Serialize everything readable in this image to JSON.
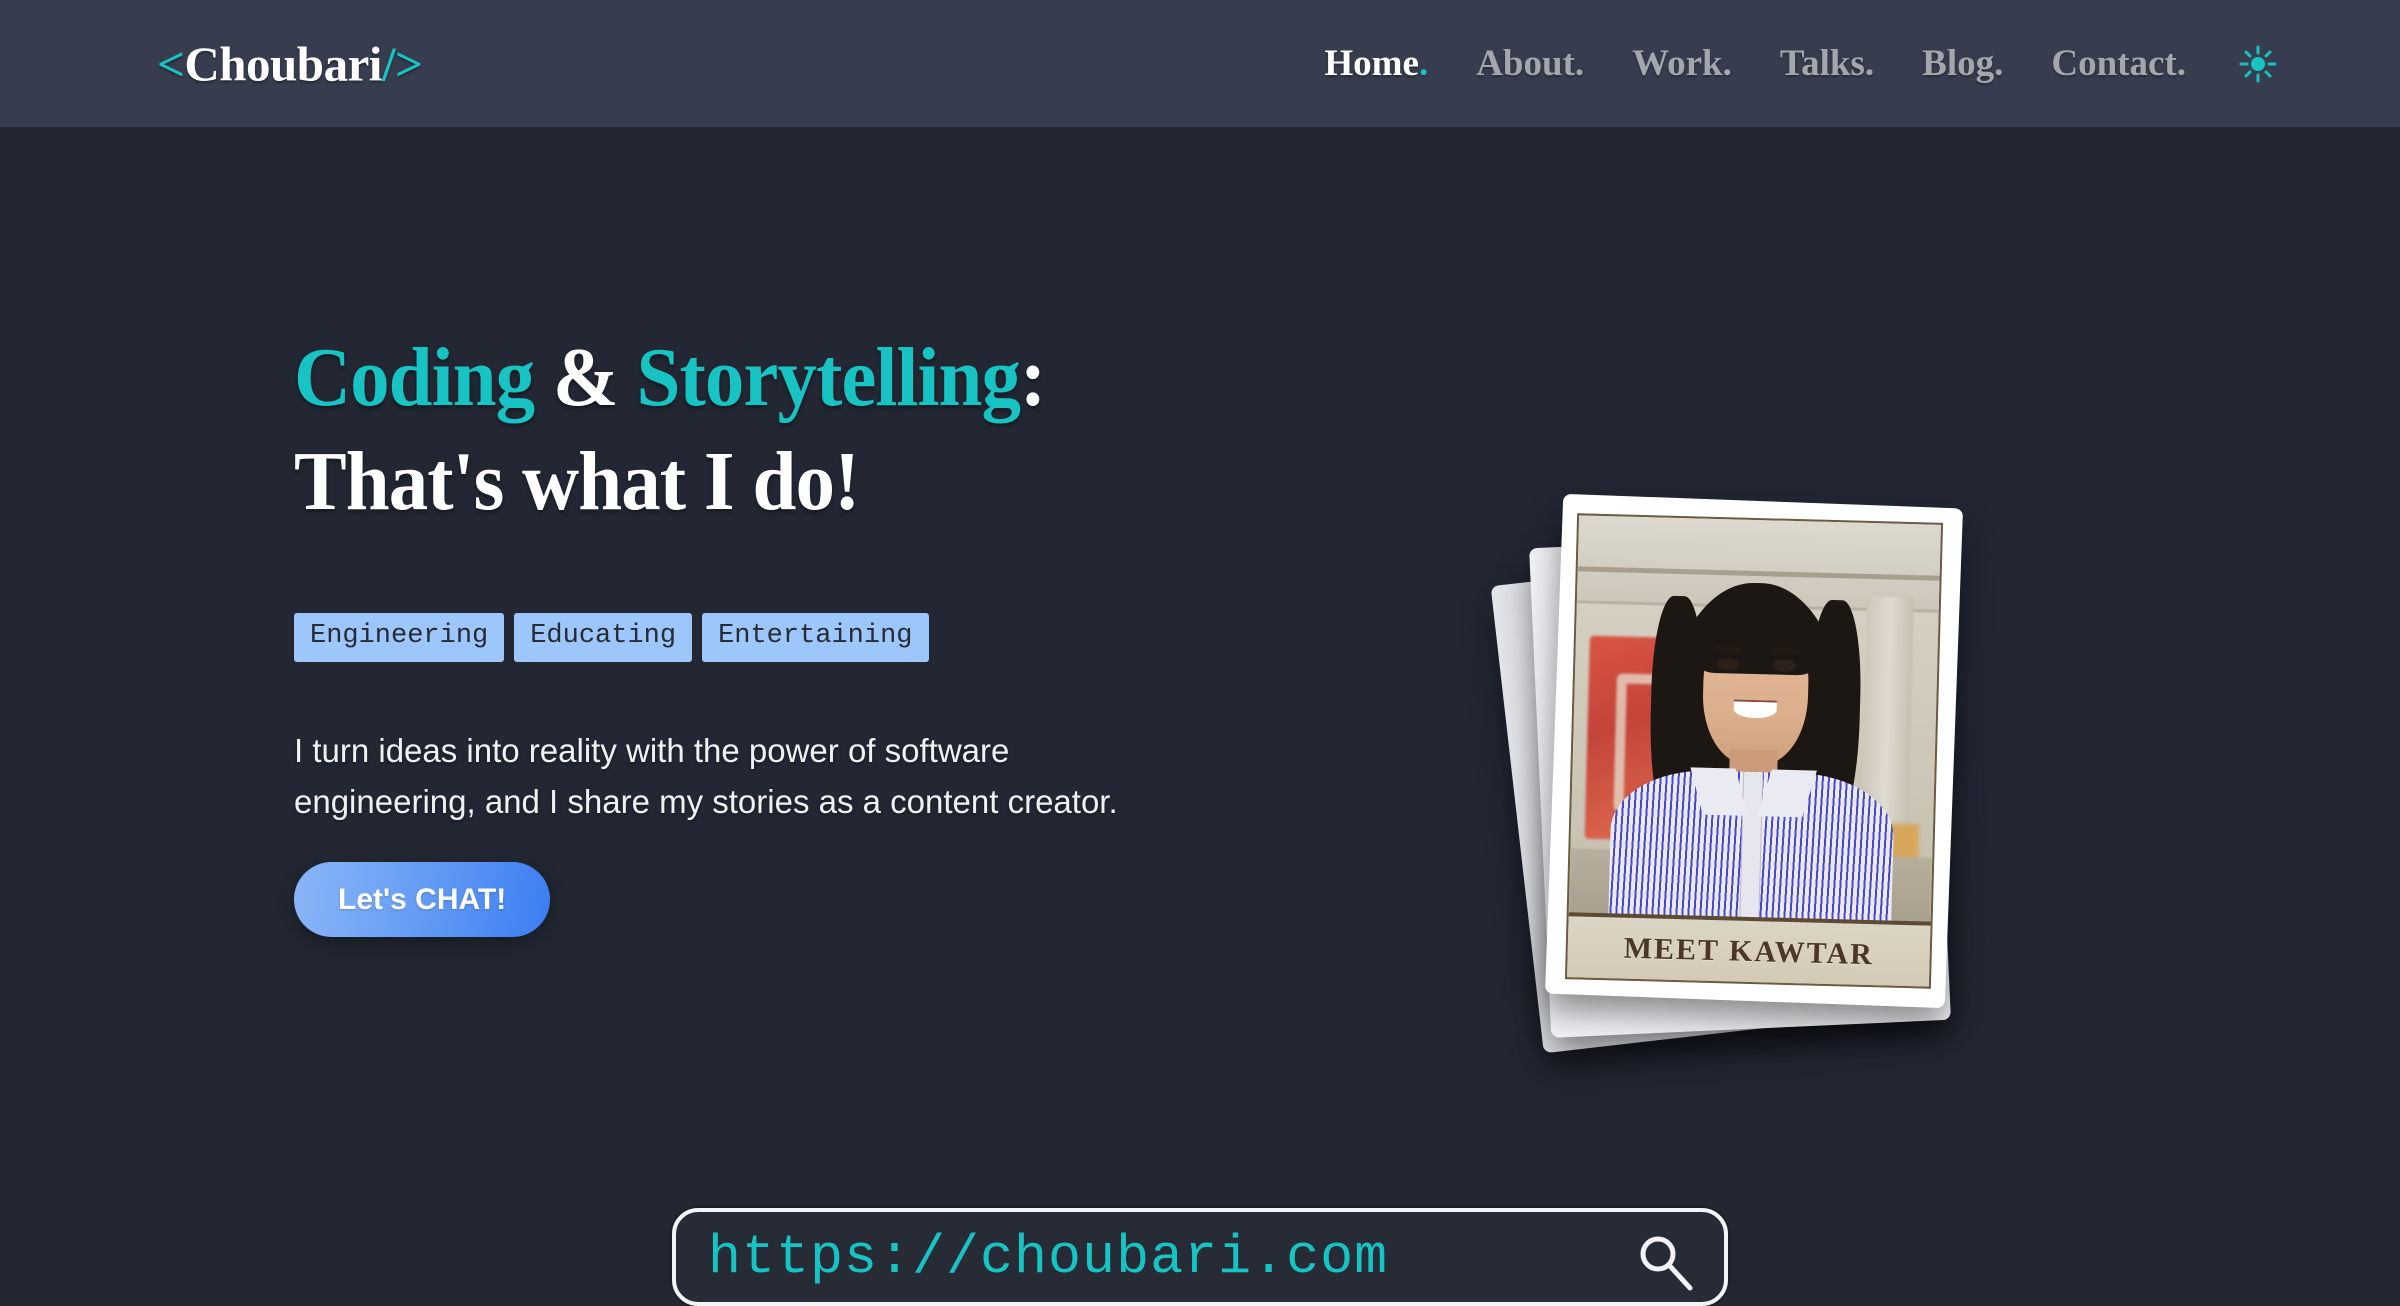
{
  "header": {
    "logo": {
      "open_bracket": "<",
      "name": "Choubari",
      "close_bracket": "/>"
    },
    "nav_items": [
      {
        "label": "Home",
        "dot": ".",
        "active": true
      },
      {
        "label": "About",
        "dot": ".",
        "active": false
      },
      {
        "label": "Work",
        "dot": ".",
        "active": false
      },
      {
        "label": "Talks",
        "dot": ".",
        "active": false
      },
      {
        "label": "Blog",
        "dot": ".",
        "active": false
      },
      {
        "label": "Contact",
        "dot": ".",
        "active": false
      }
    ],
    "theme_toggle_icon": "sun-icon"
  },
  "hero": {
    "heading": {
      "part1": "Coding",
      "part2": " & ",
      "part3": "Storytelling",
      "part4": ":",
      "line2": "That's what I do!"
    },
    "tags": [
      "Engineering",
      "Educating",
      "Entertaining"
    ],
    "description": "I turn ideas into reality with the power of software engineering, and I share my stories as a content creator.",
    "cta_label": "Let's CHAT!"
  },
  "photo_stack": {
    "caption": "MEET KAWTAR",
    "card_count": 3
  },
  "search": {
    "value": "https://choubari.com",
    "placeholder": "https://choubari.com",
    "icon": "search-icon"
  },
  "colors": {
    "header_bg": "#373d4e",
    "page_bg": "#222733",
    "accent_teal": "#17c3c3",
    "nav_inactive": "#a4a6ad",
    "tag_bg": "#9dc6fb",
    "tag_text": "#262b36",
    "cta_gradient_from": "#8bb6f7",
    "cta_gradient_to": "#3b7ef2",
    "heading_white": "#ffffff",
    "caption_text": "#4a3726"
  }
}
